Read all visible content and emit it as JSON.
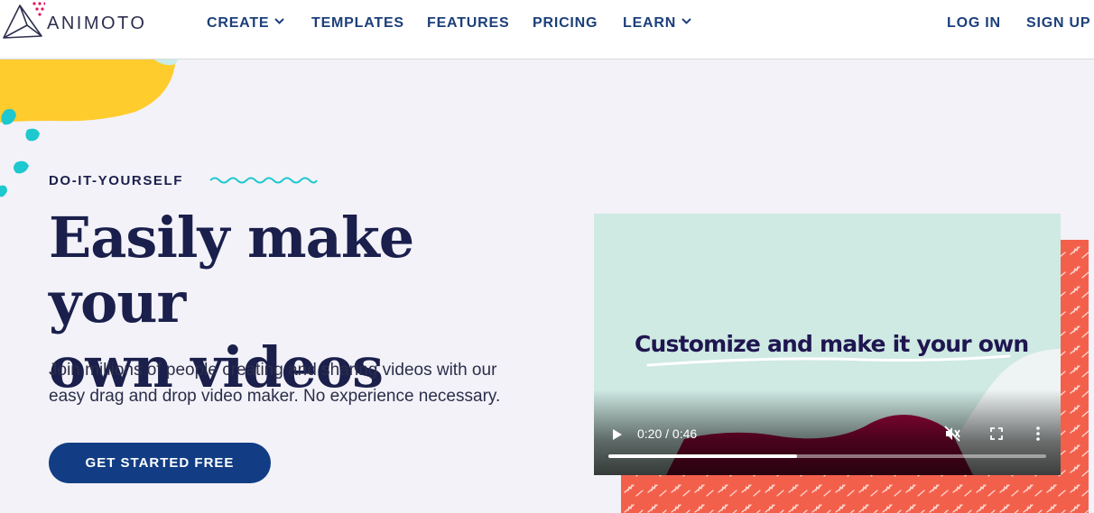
{
  "header": {
    "brand": "ANIMOTO",
    "nav": [
      {
        "label": "CREATE",
        "has_dropdown": true
      },
      {
        "label": "TEMPLATES",
        "has_dropdown": false
      },
      {
        "label": "FEATURES",
        "has_dropdown": false
      },
      {
        "label": "PRICING",
        "has_dropdown": false
      },
      {
        "label": "LEARN",
        "has_dropdown": true
      }
    ],
    "login_label": "LOG IN",
    "signup_label": "SIGN UP"
  },
  "hero": {
    "eyebrow": "DO-IT-YOURSELF",
    "headline_line1": "Easily make your",
    "headline_line2": "own videos",
    "subcopy_line1": "Join millions of people creating and sharing videos with our",
    "subcopy_line2": "easy drag and drop video maker. No experience necessary.",
    "cta_label": "GET STARTED FREE"
  },
  "video": {
    "caption": "Customize and make it your own",
    "time": "0:20 / 0:46",
    "progress": 0.43,
    "muted": true
  },
  "colors": {
    "nav_text": "#1c3f7a",
    "heading": "#1a1f4c",
    "cta_bg": "#123d85",
    "accent_teal": "#1ec8cf",
    "accent_yellow": "#ffcc2e",
    "pattern_coral": "#f2604c",
    "video_bg": "#cfe9e3"
  },
  "icons": [
    "animoto-logo-icon",
    "chevron-down-icon",
    "squiggle-icon",
    "play-icon",
    "volume-muted-icon",
    "fullscreen-icon",
    "more-vert-icon"
  ]
}
